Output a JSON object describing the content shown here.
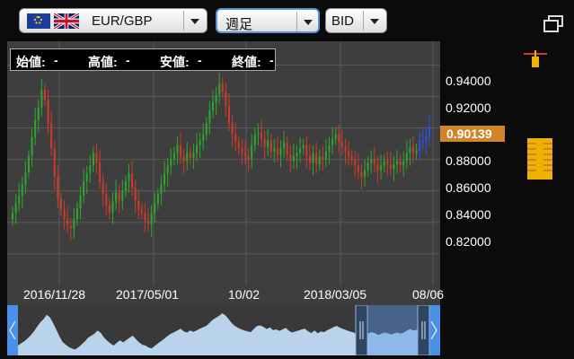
{
  "toolbar": {
    "pair": "EUR/GBP",
    "period": "週足",
    "price_type": "BID"
  },
  "ohlc": {
    "open_label": "始値:",
    "open_value": "-",
    "high_label": "高値:",
    "high_value": "-",
    "low_label": "安値:",
    "low_value": "-",
    "close_label": "終値:",
    "close_value": "-"
  },
  "price_axis": {
    "ticks": [
      "0.94000",
      "0.92000",
      "0.88000",
      "0.86000",
      "0.84000",
      "0.82000"
    ],
    "current": "0.90139"
  },
  "date_axis": {
    "ticks": [
      "2016/11/28",
      "2017/05/01",
      "10/02",
      "2018/03/05",
      "08/06"
    ]
  },
  "colors": {
    "up": "#2fa82f",
    "down": "#d23a2a",
    "latest": "#2b55e8",
    "current_badge": "#d2842a",
    "navigator_fill": "#b9d4ea",
    "handle": "#4a8fe8"
  },
  "chart_data": {
    "type": "candlestick",
    "period": "weekly",
    "ylim": [
      0.8,
      0.955
    ],
    "x_ticks": [
      "2016/11/28",
      "2017/05/01",
      "10/02",
      "2018/03/05",
      "08/06"
    ],
    "y_ticks": [
      0.94,
      0.92,
      0.88,
      0.86,
      0.84,
      0.82
    ],
    "last_price": 0.90139,
    "closes": [
      0.846,
      0.852,
      0.857,
      0.864,
      0.872,
      0.882,
      0.894,
      0.905,
      0.913,
      0.924,
      0.918,
      0.903,
      0.887,
      0.869,
      0.855,
      0.848,
      0.842,
      0.838,
      0.836,
      0.842,
      0.849,
      0.857,
      0.866,
      0.871,
      0.876,
      0.884,
      0.878,
      0.866,
      0.858,
      0.851,
      0.846,
      0.853,
      0.859,
      0.854,
      0.86,
      0.866,
      0.871,
      0.862,
      0.854,
      0.848,
      0.846,
      0.841,
      0.839,
      0.846,
      0.852,
      0.858,
      0.864,
      0.871,
      0.876,
      0.88,
      0.884,
      0.889,
      0.882,
      0.879,
      0.884,
      0.881,
      0.884,
      0.889,
      0.892,
      0.896,
      0.903,
      0.911,
      0.916,
      0.921,
      0.928,
      0.923,
      0.914,
      0.903,
      0.896,
      0.891,
      0.887,
      0.884,
      0.882,
      0.88,
      0.889,
      0.896,
      0.897,
      0.893,
      0.888,
      0.892,
      0.885,
      0.887,
      0.883,
      0.887,
      0.891,
      0.883,
      0.879,
      0.882,
      0.884,
      0.887,
      0.889,
      0.882,
      0.878,
      0.884,
      0.877,
      0.882,
      0.88,
      0.885,
      0.889,
      0.893,
      0.896,
      0.891,
      0.888,
      0.885,
      0.882,
      0.88,
      0.876,
      0.872,
      0.869,
      0.873,
      0.878,
      0.88,
      0.877,
      0.873,
      0.876,
      0.879,
      0.877,
      0.874,
      0.877,
      0.879,
      0.876,
      0.879,
      0.884,
      0.888,
      0.884,
      0.886,
      0.892,
      0.891,
      0.895,
      0.901
    ]
  }
}
